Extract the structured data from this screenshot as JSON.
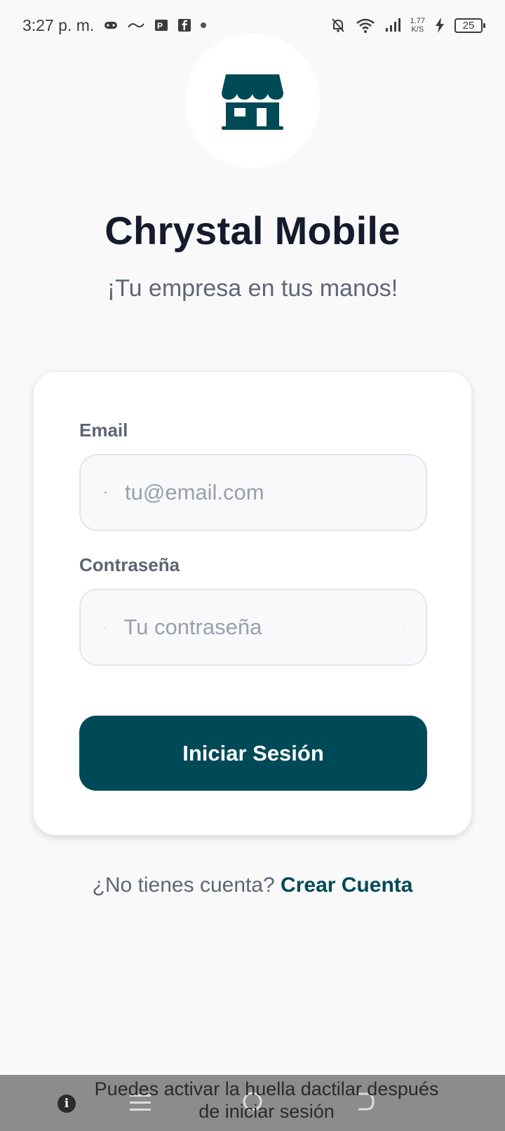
{
  "status_bar": {
    "time": "3:27 p. m.",
    "net_speed_value": "1.77",
    "net_speed_unit": "K/S",
    "battery": "25"
  },
  "app": {
    "title": "Chrystal Mobile",
    "subtitle": "¡Tu empresa en tus manos!"
  },
  "form": {
    "email_label": "Email",
    "email_placeholder": "tu@email.com",
    "email_value": "",
    "password_label": "Contraseña",
    "password_placeholder": "Tu contraseña",
    "password_value": "",
    "submit_label": "Iniciar Sesión"
  },
  "signup": {
    "prompt": "¿No tienes cuenta? ",
    "link_label": "Crear Cuenta"
  },
  "toast": {
    "message": "Puedes activar la huella dactilar después de iniciar sesión"
  },
  "icons": {
    "logo": "store-icon",
    "email": "mail-icon",
    "password": "lock-icon",
    "visibility": "eye-icon",
    "toast": "info-icon"
  },
  "colors": {
    "primary": "#004a57",
    "background": "#f9f9fa",
    "title": "#151a2c",
    "muted_text": "#5f6675",
    "placeholder": "#9aa0ab"
  }
}
